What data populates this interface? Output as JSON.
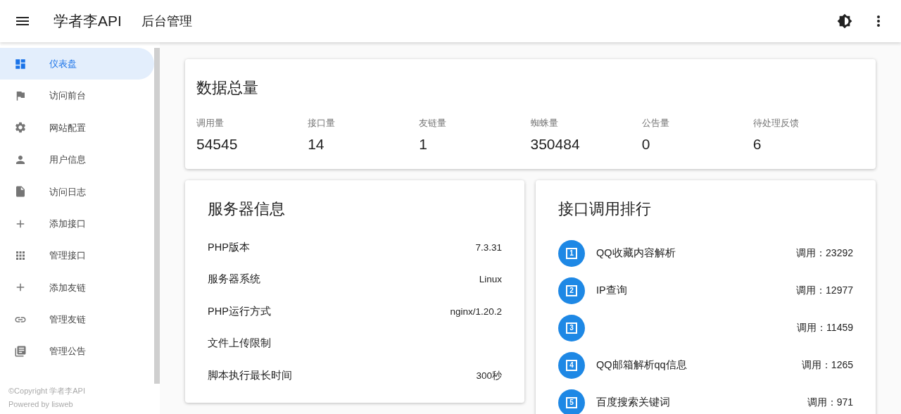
{
  "app_bar": {
    "title": "学者李API",
    "subtitle": "后台管理"
  },
  "sidebar": {
    "items": [
      {
        "label": "仪表盘",
        "selected": true
      },
      {
        "label": "访问前台",
        "selected": false
      },
      {
        "label": "网站配置",
        "selected": false
      },
      {
        "label": "用户信息",
        "selected": false
      },
      {
        "label": "访问日志",
        "selected": false
      },
      {
        "label": "添加接口",
        "selected": false
      },
      {
        "label": "管理接口",
        "selected": false
      },
      {
        "label": "添加友链",
        "selected": false
      },
      {
        "label": "管理友链",
        "selected": false
      },
      {
        "label": "管理公告",
        "selected": false
      }
    ],
    "footer": [
      "©Copyright 学者李API",
      "Powered by lisweb"
    ]
  },
  "totals": {
    "title": "数据总量",
    "stats": [
      {
        "label": "调用量",
        "value": "54545"
      },
      {
        "label": "接口量",
        "value": "14"
      },
      {
        "label": "友链量",
        "value": "1"
      },
      {
        "label": "蜘蛛量",
        "value": "350484"
      },
      {
        "label": "公告量",
        "value": "0"
      },
      {
        "label": "待处理反馈",
        "value": "6"
      }
    ]
  },
  "server_info": {
    "title": "服务器信息",
    "rows": [
      {
        "label": "PHP版本",
        "value": "7.3.31"
      },
      {
        "label": "服务器系统",
        "value": "Linux"
      },
      {
        "label": "PHP运行方式",
        "value": "nginx/1.20.2"
      },
      {
        "label": "文件上传限制"
      },
      {
        "label": "脚本执行最长时间",
        "value": "300秒"
      }
    ]
  },
  "ranking": {
    "title": "接口调用排行",
    "rows": [
      {
        "rank": "1",
        "name": "QQ收藏内容解析",
        "calls": "调用：23292"
      },
      {
        "rank": "2",
        "name": "IP查询",
        "calls": "调用：12977"
      },
      {
        "rank": "3",
        "calls": "调用：11459"
      },
      {
        "rank": "4",
        "name": "QQ邮箱解析qq信息",
        "calls": "调用：1265"
      },
      {
        "rank": "5",
        "name": "百度搜索关键词",
        "calls": "调用：971"
      }
    ]
  }
}
